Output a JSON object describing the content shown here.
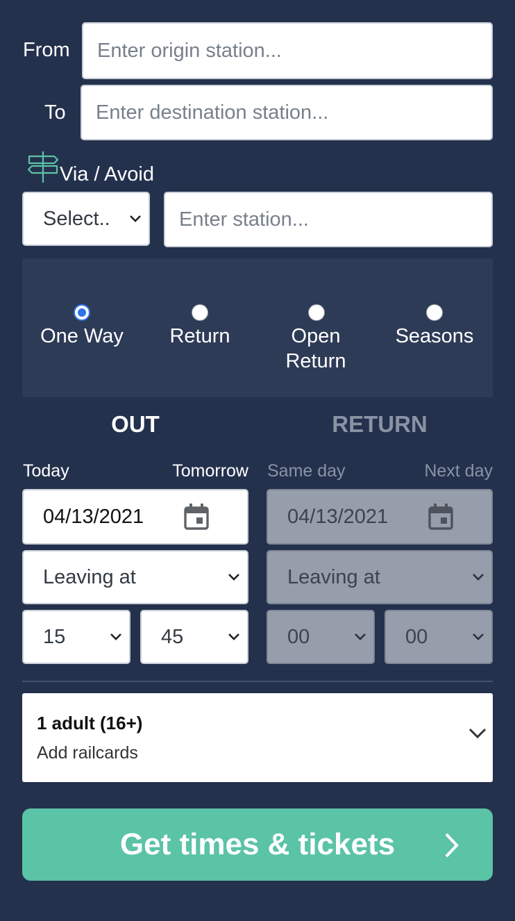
{
  "journey": {
    "from_label": "From",
    "from_placeholder": "Enter origin station...",
    "to_label": "To",
    "to_placeholder": "Enter destination station...",
    "via_label": "Via / Avoid",
    "via_select_value": "Select..",
    "via_placeholder": "Enter station..."
  },
  "ticket_types": [
    {
      "label": "One Way",
      "checked": true
    },
    {
      "label": "Return",
      "checked": false
    },
    {
      "label": "Open Return",
      "checked": false
    },
    {
      "label": "Seasons",
      "checked": false
    }
  ],
  "out": {
    "header": "OUT",
    "today_link": "Today",
    "tomorrow_link": "Tomorrow",
    "date": "04/13/2021",
    "time_mode": "Leaving at",
    "hour": "15",
    "minute": "45"
  },
  "return": {
    "header": "RETURN",
    "same_day_link": "Same day",
    "next_day_link": "Next day",
    "date": "04/13/2021",
    "time_mode": "Leaving at",
    "hour": "00",
    "minute": "00"
  },
  "passengers": {
    "summary": "1 adult (16+)",
    "railcards": "Add railcards"
  },
  "submit_label": "Get times & tickets",
  "colors": {
    "background": "#24314d",
    "panel": "#2e3b57",
    "accent": "#5bc3a6",
    "radio_selected": "#2f74e8",
    "disabled_field": "#969dab"
  }
}
